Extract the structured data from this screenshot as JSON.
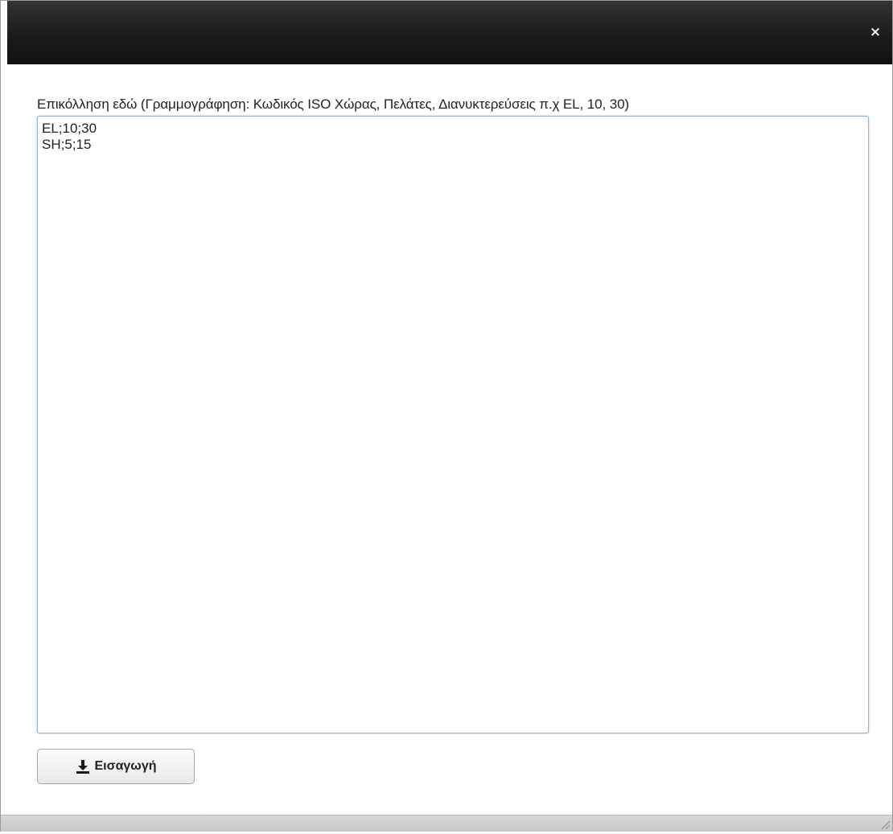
{
  "dialog": {
    "close_symbol": "×"
  },
  "form": {
    "label": "Επικόλληση εδώ (Γραμμογράφηση: Κωδικός ISO Χώρας, Πελάτες, Διανυκτερεύσεις π.χ EL, 10, 30)",
    "textarea_value": "EL;10;30\nSH;5;15"
  },
  "actions": {
    "import_label": "Εισαγωγή",
    "import_icon": "download-icon"
  }
}
